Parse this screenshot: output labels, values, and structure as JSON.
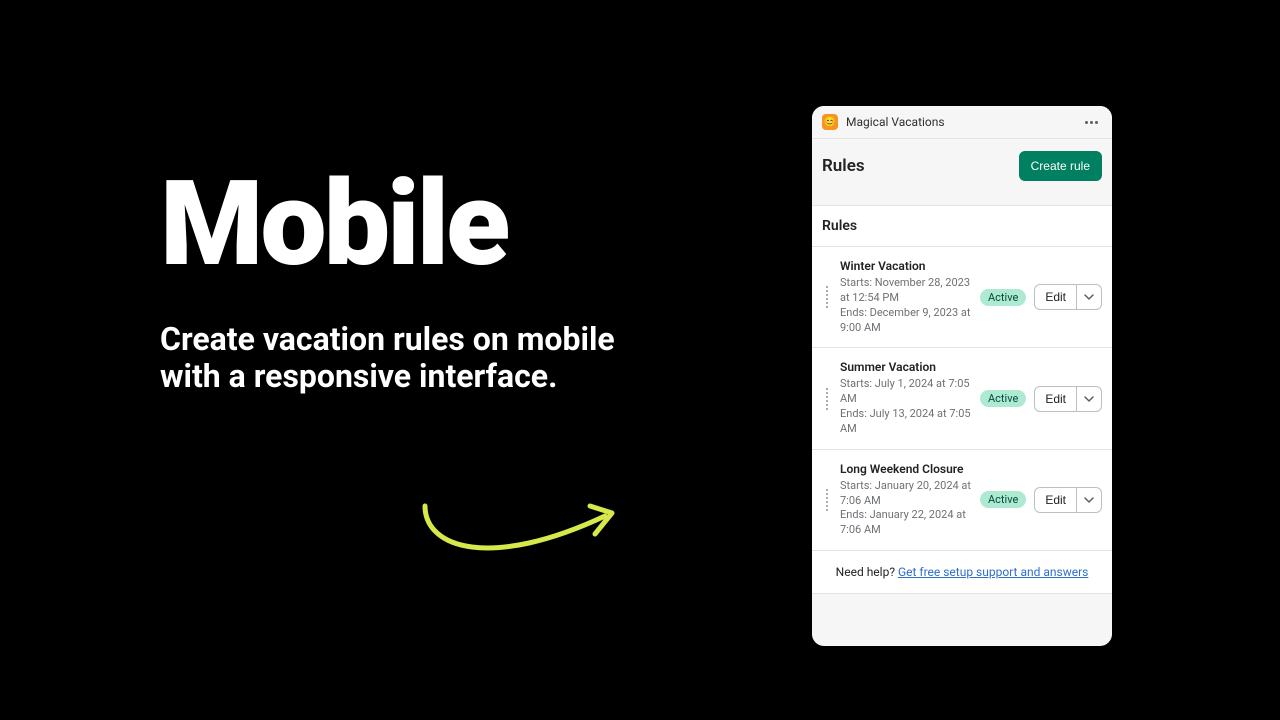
{
  "hero": {
    "title": "Mobile",
    "subtitle": "Create vacation rules on mobile with a responsive interface."
  },
  "app": {
    "name": "Magical Vacations",
    "icon_emoji": "😊"
  },
  "page": {
    "title": "Rules",
    "create_label": "Create rule",
    "section_title": "Rules"
  },
  "rules": [
    {
      "name": "Winter Vacation",
      "starts": "Starts: November 28, 2023 at 12:54 PM",
      "ends": "Ends: December 9, 2023 at 9:00 AM",
      "status": "Active",
      "edit": "Edit"
    },
    {
      "name": "Summer Vacation",
      "starts": "Starts: July 1, 2024 at 7:05 AM",
      "ends": "Ends: July 13, 2024 at 7:05 AM",
      "status": "Active",
      "edit": "Edit"
    },
    {
      "name": "Long Weekend Closure",
      "starts": "Starts: January 20, 2024 at 7:06 AM",
      "ends": "Ends: January 22, 2024 at 7:06 AM",
      "status": "Active",
      "edit": "Edit"
    }
  ],
  "help": {
    "prefix": "Need help? ",
    "link": "Get free setup support and answers"
  }
}
